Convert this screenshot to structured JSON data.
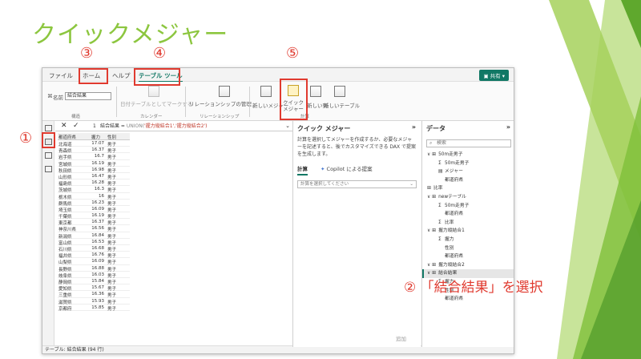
{
  "slide": {
    "title": "クイックメジャー",
    "markers": {
      "m1": "①",
      "m3": "③",
      "m4": "④",
      "m5": "⑤"
    },
    "callout": "② 「結合結果」を選択"
  },
  "app": {
    "tabs": [
      "ファイル",
      "ホーム",
      "ヘルプ",
      "テーブル ツール"
    ],
    "share_label": "共有",
    "ribbon": {
      "name_label": "名前",
      "name_value": "結合結果",
      "group_structure": "構造",
      "mark_date_table": "日付テーブルとしてマークする",
      "group_calendar": "カレンダー",
      "manage_relationships": "リレーションシップの管理",
      "group_relationships": "リレーションシップ",
      "new_measure": "新しいメジャー",
      "quick_measure": "クイック メジャー",
      "new_column": "新しい列",
      "new_table": "新しいテーブル",
      "group_calc": "計算"
    },
    "formula": {
      "line": "1",
      "prefix": "結合結果 = ",
      "func": "UNION(",
      "args": "'握力縦結合1','握力縦結合2')"
    },
    "table": {
      "headers": [
        "都道府県",
        "握力",
        "性別"
      ],
      "rows": [
        [
          "北海道",
          "17.07",
          "男子"
        ],
        [
          "青森県",
          "16.37",
          "男子"
        ],
        [
          "岩手県",
          "16.7",
          "男子"
        ],
        [
          "宮城県",
          "16.19",
          "男子"
        ],
        [
          "秋田県",
          "16.98",
          "男子"
        ],
        [
          "山形県",
          "16.47",
          "男子"
        ],
        [
          "福島県",
          "16.28",
          "男子"
        ],
        [
          "茨城県",
          "16.3",
          "男子"
        ],
        [
          "栃木県",
          "16",
          "男子"
        ],
        [
          "群馬県",
          "16.23",
          "男子"
        ],
        [
          "埼玉県",
          "16.09",
          "男子"
        ],
        [
          "千葉県",
          "16.19",
          "男子"
        ],
        [
          "東京都",
          "16.37",
          "男子"
        ],
        [
          "神奈川県",
          "16.56",
          "男子"
        ],
        [
          "新潟県",
          "16.84",
          "男子"
        ],
        [
          "富山県",
          "16.53",
          "男子"
        ],
        [
          "石川県",
          "16.68",
          "男子"
        ],
        [
          "福井県",
          "16.76",
          "男子"
        ],
        [
          "山梨県",
          "16.09",
          "男子"
        ],
        [
          "長野県",
          "16.88",
          "男子"
        ],
        [
          "岐阜県",
          "16.03",
          "男子"
        ],
        [
          "静岡県",
          "15.84",
          "男子"
        ],
        [
          "愛知県",
          "15.67",
          "男子"
        ],
        [
          "三重県",
          "16.36",
          "男子"
        ],
        [
          "滋賀県",
          "15.93",
          "男子"
        ],
        [
          "京都府",
          "15.85",
          "男子"
        ]
      ]
    },
    "status": "テーブル: 結合結果 (94 行)",
    "quick_panel": {
      "title": "クイック メジャー",
      "description": "計算を選択してメジャーを作成するか、必要なメジャーを記述すると、後でカスタマイズできる DAX で提案を生成します。",
      "tab_calc": "計算",
      "tab_copilot": "Copilot による提案",
      "select_placeholder": "計算を選択してください",
      "add_label": "追加"
    },
    "data_panel": {
      "title": "データ",
      "search_placeholder": "検索",
      "items": [
        {
          "label": "50m走男子",
          "level": 0,
          "kind": "table"
        },
        {
          "label": "50m走男子",
          "level": 1,
          "kind": "sum"
        },
        {
          "label": "メジャー",
          "level": 1,
          "kind": "measure"
        },
        {
          "label": "都道府県",
          "level": 1,
          "kind": "field"
        },
        {
          "label": "比率",
          "level": 0,
          "kind": "table-plain"
        },
        {
          "label": "newテーブル",
          "level": 0,
          "kind": "table"
        },
        {
          "label": "50m走男子",
          "level": 1,
          "kind": "sum"
        },
        {
          "label": "都道府県",
          "level": 1,
          "kind": "field"
        },
        {
          "label": "比率",
          "level": 1,
          "kind": "sum"
        },
        {
          "label": "握力縦結合1",
          "level": 0,
          "kind": "table"
        },
        {
          "label": "握力",
          "level": 1,
          "kind": "sum"
        },
        {
          "label": "性別",
          "level": 1,
          "kind": "field"
        },
        {
          "label": "都道府県",
          "level": 1,
          "kind": "field"
        },
        {
          "label": "握力縦結合2",
          "level": 0,
          "kind": "table"
        },
        {
          "label": "結合結果",
          "level": 0,
          "kind": "table",
          "selected": true
        },
        {
          "label": "握力",
          "level": 1,
          "kind": "sum"
        },
        {
          "label": "性別",
          "level": 1,
          "kind": "field"
        },
        {
          "label": "都道府県",
          "level": 1,
          "kind": "field"
        }
      ]
    }
  },
  "colors": {
    "accent": "#117865",
    "title_green": "#8cc63f",
    "annotation_red": "#e03a2f"
  }
}
